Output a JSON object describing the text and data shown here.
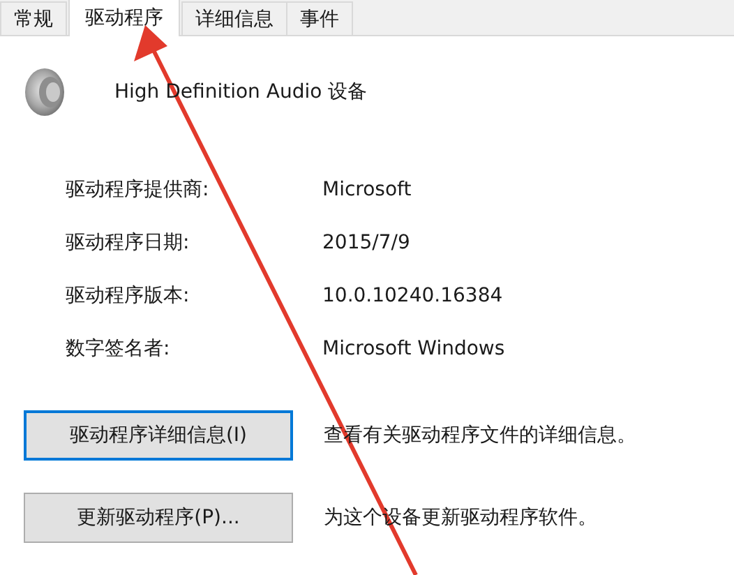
{
  "tabs": [
    {
      "label": "常规",
      "selected": false
    },
    {
      "label": "驱动程序",
      "selected": true
    },
    {
      "label": "详细信息",
      "selected": false
    },
    {
      "label": "事件",
      "selected": false
    }
  ],
  "device": {
    "name": "High Definition Audio 设备"
  },
  "properties": [
    {
      "label": "驱动程序提供商:",
      "value": "Microsoft"
    },
    {
      "label": "驱动程序日期:",
      "value": "2015/7/9"
    },
    {
      "label": "驱动程序版本:",
      "value": "10.0.10240.16384"
    },
    {
      "label": "数字签名者:",
      "value": "Microsoft Windows"
    }
  ],
  "actions": [
    {
      "button": "驱动程序详细信息(I)",
      "focused": true,
      "description": "查看有关驱动程序文件的详细信息。"
    },
    {
      "button": "更新驱动程序(P)...",
      "focused": false,
      "description": "为这个设备更新驱动程序软件。"
    }
  ]
}
